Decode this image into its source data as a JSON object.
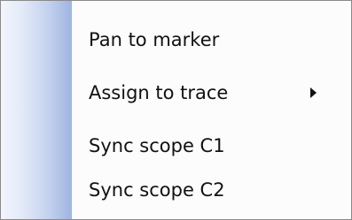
{
  "context_menu": {
    "items": [
      {
        "label": "Pan to marker",
        "has_submenu": false
      },
      {
        "label": "Assign to trace",
        "has_submenu": true,
        "submenu_icon": "triangle-right-icon"
      },
      {
        "label": "Sync scope C1",
        "has_submenu": false
      },
      {
        "label": "Sync scope C2",
        "has_submenu": false
      }
    ]
  }
}
